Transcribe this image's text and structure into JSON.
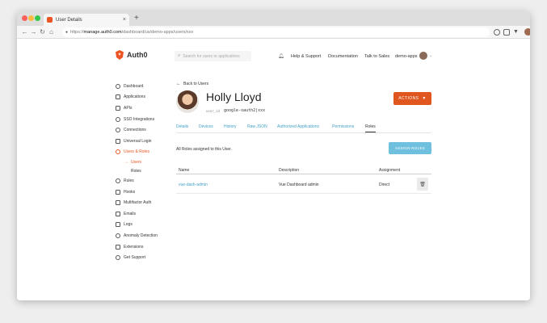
{
  "browser": {
    "tab_title": "User Details",
    "tab_close": "×",
    "new_tab": "+",
    "url_proto": "https://",
    "url_host": "manage.auth0.com",
    "url_path": "/dashboard/us/demo-apps/users/xxx"
  },
  "header": {
    "logo_text": "Auth0",
    "search_placeholder": "Search for users or applications",
    "links": [
      "Help & Support",
      "Documentation",
      "Talk to Sales",
      "demo-apps"
    ]
  },
  "sidebar": {
    "items": [
      {
        "label": "Dashboard",
        "icon": "dashboard-icon"
      },
      {
        "label": "Applications",
        "icon": "applications-icon"
      },
      {
        "label": "APIs",
        "icon": "apis-icon"
      },
      {
        "label": "SSO Integrations",
        "icon": "sso-icon"
      },
      {
        "label": "Connections",
        "icon": "connections-icon"
      },
      {
        "label": "Universal Login",
        "icon": "universal-login-icon"
      },
      {
        "label": "Users & Roles",
        "icon": "users-roles-icon",
        "active": true
      }
    ],
    "subitems": [
      {
        "label": "Users",
        "active": true
      },
      {
        "label": "Roles"
      }
    ],
    "items_after": [
      {
        "label": "Rules",
        "icon": "rules-icon"
      },
      {
        "label": "Hooks",
        "icon": "hooks-icon"
      },
      {
        "label": "Multifactor Auth",
        "icon": "mfa-icon"
      },
      {
        "label": "Emails",
        "icon": "emails-icon"
      },
      {
        "label": "Logs",
        "icon": "logs-icon"
      },
      {
        "label": "Anomaly Detection",
        "icon": "anomaly-icon"
      },
      {
        "label": "Extensions",
        "icon": "extensions-icon"
      },
      {
        "label": "Get Support",
        "icon": "support-icon"
      }
    ]
  },
  "main": {
    "back_label": "Back to Users",
    "user_name": "Holly Lloyd",
    "user_id_label": "user_id",
    "user_id_value": "google-oauth2|xxx",
    "actions_label": "ACTIONS",
    "tabs": [
      "Details",
      "Devices",
      "History",
      "Raw JSON",
      "Authorized Applications",
      "Permissions",
      "Roles"
    ],
    "active_tab": "Roles",
    "roles_description": "All Roles assigned to this User.",
    "assign_button": "ASSIGN ROLES",
    "table": {
      "headers": [
        "Name",
        "Description",
        "Assignment"
      ],
      "rows": [
        {
          "name": "vue-dash-admin",
          "description": "Vue Dashboard admin",
          "assignment": "Direct"
        }
      ]
    }
  }
}
